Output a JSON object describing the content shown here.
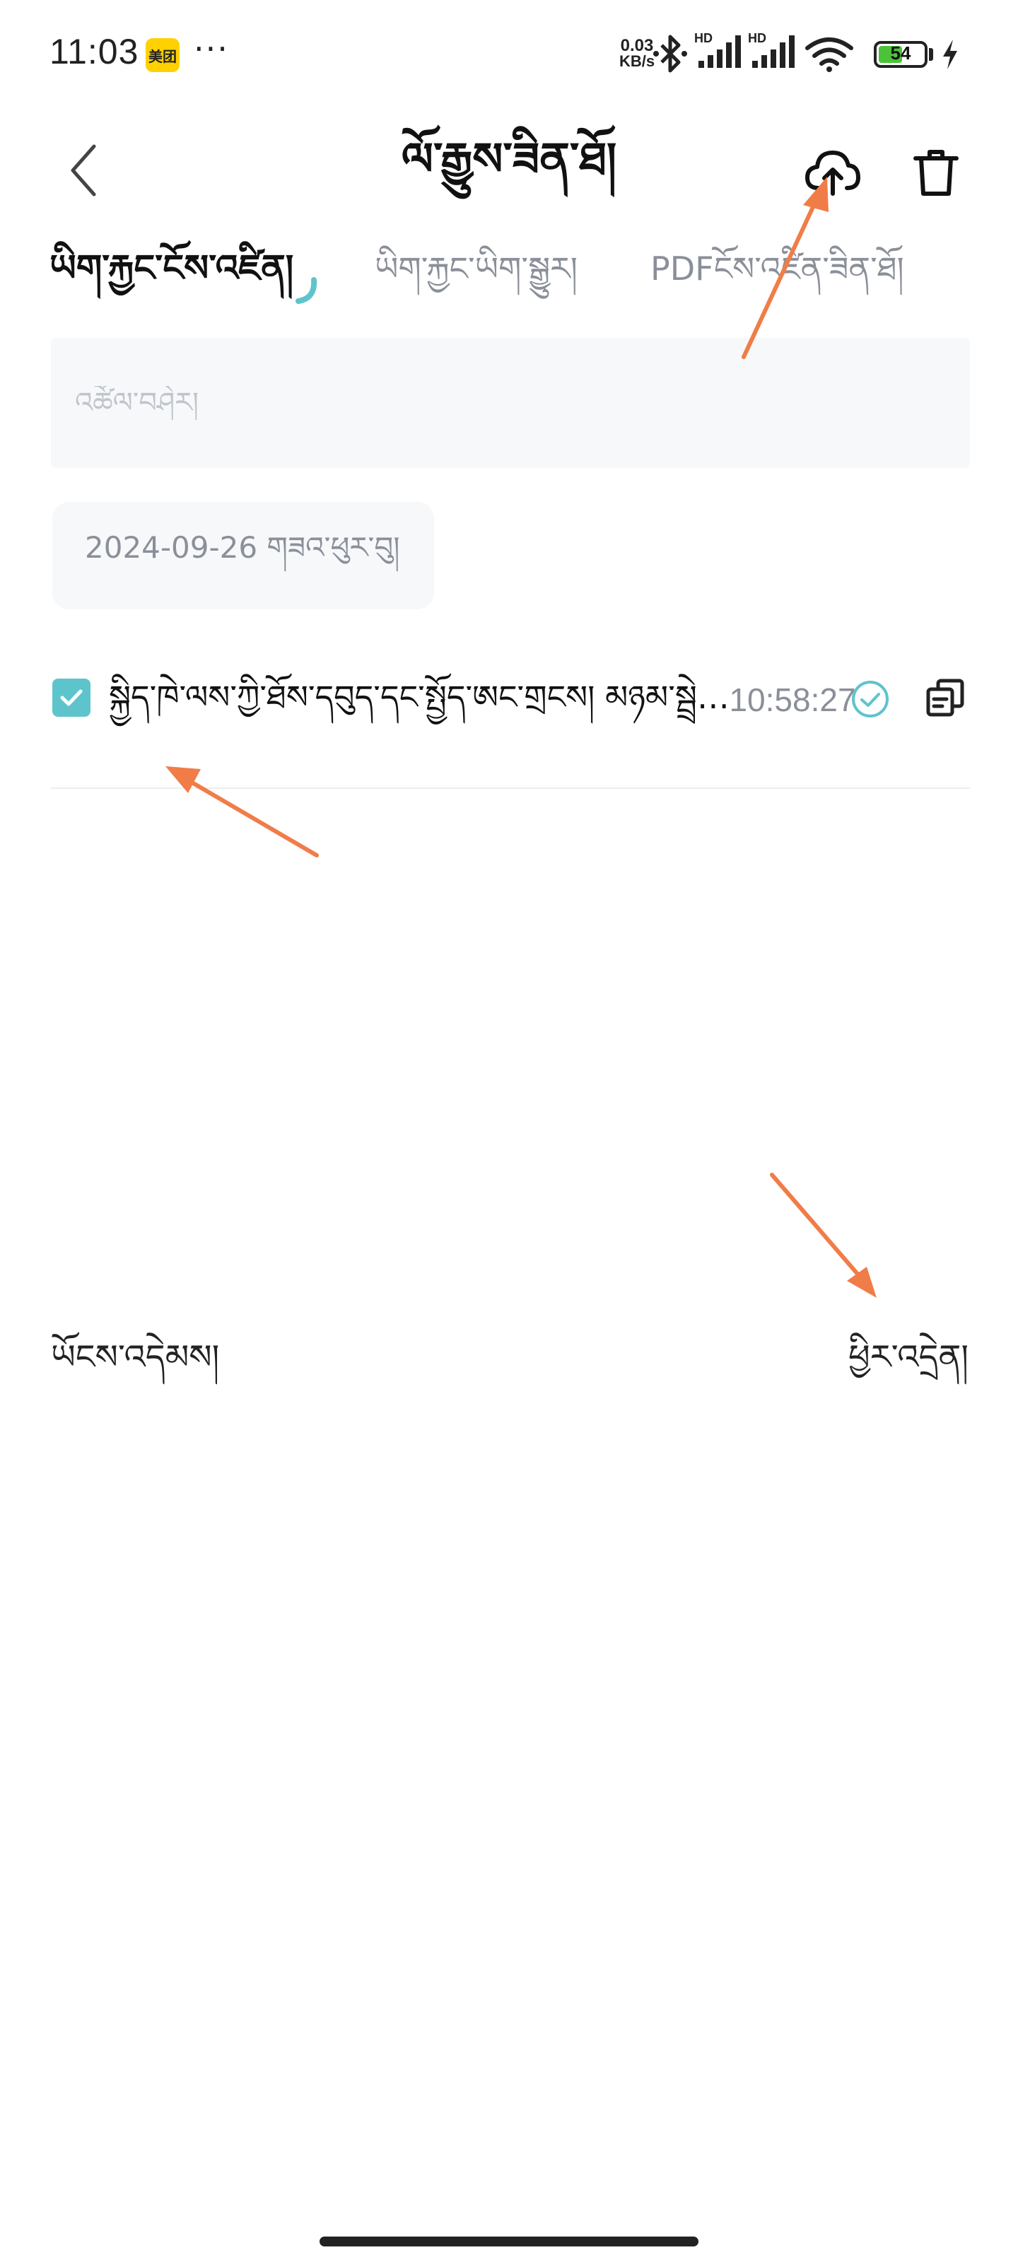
{
  "status_bar": {
    "time": "11:03",
    "app_badge": "美团",
    "more": "···",
    "net_speed_value": "0.03",
    "net_speed_unit": "KB/s",
    "signal_1_label": "HD",
    "signal_2_label": "HD",
    "battery_level": "54",
    "battery_fraction": 0.54
  },
  "header": {
    "title": "ལོ་རྒྱུས་ཟིན་ཐོ།",
    "back_icon": "chevron-left-icon",
    "upload_icon": "cloud-upload-icon",
    "delete_icon": "trash-icon"
  },
  "tabs": [
    {
      "label": "ཡིག་རྐྱང་ངོས་འཛིན།",
      "active": true
    },
    {
      "label": "ཡིག་རྐྱང་ཡིག་སྒྱུར།",
      "active": false
    },
    {
      "label": "PDFངོས་འཛིན་ཟིན་ཐོ།",
      "active": false
    }
  ],
  "search": {
    "placeholder": "འཚོལ་བཤེར།",
    "value": ""
  },
  "date_group": {
    "label": "2024-09-26 གཟའ་ཕུར་བུ།"
  },
  "records": [
    {
      "title": "སྐྱིད་ཁེ་ལས་ཀྱི་ཐོས་དབུད་དང་སྤྱོད་ཨང་གྲངས། མཉམ་སྦྲེལ་བྱ་རྒྱུ།",
      "time": "10:58:27",
      "checked": true,
      "status_icon": "check-circle-icon",
      "copy_icon": "copy-icon"
    }
  ],
  "bottom_actions": {
    "left_label": "ཡོངས་འདེམས།",
    "right_label": "ཕྱིར་འདྲེན།"
  },
  "colors": {
    "accent": "#5ec4cc",
    "annotation_arrow": "#f07d48",
    "muted_text": "#8a8f99",
    "field_background": "#f7f8fa"
  }
}
